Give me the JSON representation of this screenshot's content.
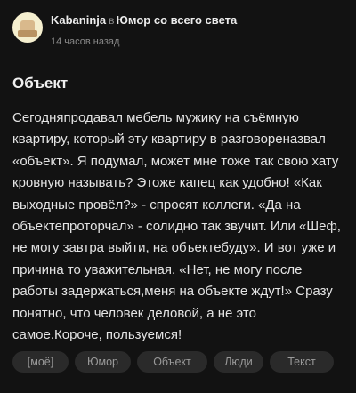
{
  "post": {
    "author": "Kabaninja",
    "in_word": "в",
    "community": "Юмор со всего света",
    "time": "14 часов назад",
    "title": "Объект",
    "body": "Сегодняпродавал мебель мужику на съёмную квартиру, который эту квартиру в разговореназвал «объект». Я подумал, может мне тоже так свою хату кровную называть? Этоже капец как удобно! «Как выходные провёл?» - спросят коллеги. «Да на объектепроторчал» - солидно так звучит. Или «Шеф, не могу завтра выйти, на объектебуду». И вот уже и причина то уважительная. «Нет, не могу после работы задержаться,меня на объекте ждут!» Сразу понятно, что человек деловой, а не это самое.Короче, пользуемся!",
    "tags": [
      "[моё]",
      "Юмор",
      "Объект",
      "Люди",
      "Текст"
    ]
  }
}
